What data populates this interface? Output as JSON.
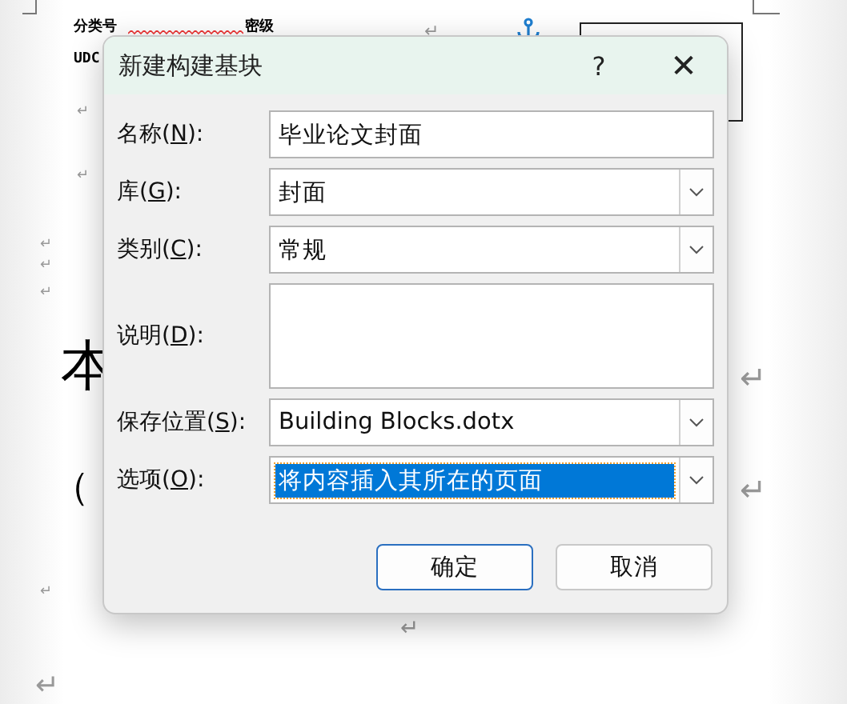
{
  "document": {
    "header_labels": [
      "分类号",
      "密级",
      "UDC"
    ],
    "headline": "本",
    "subtitle": "（",
    "paragraph_marks": [
      "↵",
      "↵",
      "↵",
      "↵",
      "↵",
      "↵",
      "↵",
      "↵",
      "↵",
      "↵",
      "↵"
    ]
  },
  "dialog": {
    "title": "新建构建基块",
    "help": "?",
    "close": "✕",
    "fields": [
      {
        "kind": "text",
        "label": "名称(",
        "access_key": "N",
        "label_end": "):",
        "value": "毕业论文封面",
        "selected": false
      },
      {
        "kind": "dropdown",
        "label": "库(",
        "access_key": "G",
        "label_end": "):",
        "value": "封面",
        "selected": false
      },
      {
        "kind": "dropdown",
        "label": "类别(",
        "access_key": "C",
        "label_end": "):",
        "value": "常规",
        "selected": false
      },
      {
        "kind": "textarea",
        "label": "说明(",
        "access_key": "D",
        "label_end": "):",
        "selected": false
      },
      {
        "kind": "dropdown",
        "label": "保存位置(",
        "access_key": "S",
        "label_end": "):",
        "value": "Building Blocks.dotx",
        "selected": false
      },
      {
        "kind": "dropdown",
        "label": "选项(",
        "access_key": "O",
        "label_end": "):",
        "value": "将内容插入其所在的页面",
        "selected": true
      }
    ],
    "buttons": [
      {
        "label": "确定",
        "default": true
      },
      {
        "label": "取消",
        "default": false
      }
    ]
  }
}
